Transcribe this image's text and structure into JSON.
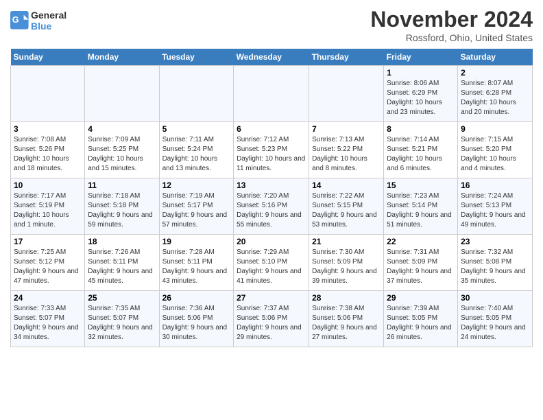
{
  "logo": {
    "line1": "General",
    "line2": "Blue"
  },
  "title": "November 2024",
  "location": "Rossford, Ohio, United States",
  "days_of_week": [
    "Sunday",
    "Monday",
    "Tuesday",
    "Wednesday",
    "Thursday",
    "Friday",
    "Saturday"
  ],
  "weeks": [
    [
      {
        "day": "",
        "info": ""
      },
      {
        "day": "",
        "info": ""
      },
      {
        "day": "",
        "info": ""
      },
      {
        "day": "",
        "info": ""
      },
      {
        "day": "",
        "info": ""
      },
      {
        "day": "1",
        "info": "Sunrise: 8:06 AM\nSunset: 6:29 PM\nDaylight: 10 hours and 23 minutes."
      },
      {
        "day": "2",
        "info": "Sunrise: 8:07 AM\nSunset: 6:28 PM\nDaylight: 10 hours and 20 minutes."
      }
    ],
    [
      {
        "day": "3",
        "info": "Sunrise: 7:08 AM\nSunset: 5:26 PM\nDaylight: 10 hours and 18 minutes."
      },
      {
        "day": "4",
        "info": "Sunrise: 7:09 AM\nSunset: 5:25 PM\nDaylight: 10 hours and 15 minutes."
      },
      {
        "day": "5",
        "info": "Sunrise: 7:11 AM\nSunset: 5:24 PM\nDaylight: 10 hours and 13 minutes."
      },
      {
        "day": "6",
        "info": "Sunrise: 7:12 AM\nSunset: 5:23 PM\nDaylight: 10 hours and 11 minutes."
      },
      {
        "day": "7",
        "info": "Sunrise: 7:13 AM\nSunset: 5:22 PM\nDaylight: 10 hours and 8 minutes."
      },
      {
        "day": "8",
        "info": "Sunrise: 7:14 AM\nSunset: 5:21 PM\nDaylight: 10 hours and 6 minutes."
      },
      {
        "day": "9",
        "info": "Sunrise: 7:15 AM\nSunset: 5:20 PM\nDaylight: 10 hours and 4 minutes."
      }
    ],
    [
      {
        "day": "10",
        "info": "Sunrise: 7:17 AM\nSunset: 5:19 PM\nDaylight: 10 hours and 1 minute."
      },
      {
        "day": "11",
        "info": "Sunrise: 7:18 AM\nSunset: 5:18 PM\nDaylight: 9 hours and 59 minutes."
      },
      {
        "day": "12",
        "info": "Sunrise: 7:19 AM\nSunset: 5:17 PM\nDaylight: 9 hours and 57 minutes."
      },
      {
        "day": "13",
        "info": "Sunrise: 7:20 AM\nSunset: 5:16 PM\nDaylight: 9 hours and 55 minutes."
      },
      {
        "day": "14",
        "info": "Sunrise: 7:22 AM\nSunset: 5:15 PM\nDaylight: 9 hours and 53 minutes."
      },
      {
        "day": "15",
        "info": "Sunrise: 7:23 AM\nSunset: 5:14 PM\nDaylight: 9 hours and 51 minutes."
      },
      {
        "day": "16",
        "info": "Sunrise: 7:24 AM\nSunset: 5:13 PM\nDaylight: 9 hours and 49 minutes."
      }
    ],
    [
      {
        "day": "17",
        "info": "Sunrise: 7:25 AM\nSunset: 5:12 PM\nDaylight: 9 hours and 47 minutes."
      },
      {
        "day": "18",
        "info": "Sunrise: 7:26 AM\nSunset: 5:11 PM\nDaylight: 9 hours and 45 minutes."
      },
      {
        "day": "19",
        "info": "Sunrise: 7:28 AM\nSunset: 5:11 PM\nDaylight: 9 hours and 43 minutes."
      },
      {
        "day": "20",
        "info": "Sunrise: 7:29 AM\nSunset: 5:10 PM\nDaylight: 9 hours and 41 minutes."
      },
      {
        "day": "21",
        "info": "Sunrise: 7:30 AM\nSunset: 5:09 PM\nDaylight: 9 hours and 39 minutes."
      },
      {
        "day": "22",
        "info": "Sunrise: 7:31 AM\nSunset: 5:09 PM\nDaylight: 9 hours and 37 minutes."
      },
      {
        "day": "23",
        "info": "Sunrise: 7:32 AM\nSunset: 5:08 PM\nDaylight: 9 hours and 35 minutes."
      }
    ],
    [
      {
        "day": "24",
        "info": "Sunrise: 7:33 AM\nSunset: 5:07 PM\nDaylight: 9 hours and 34 minutes."
      },
      {
        "day": "25",
        "info": "Sunrise: 7:35 AM\nSunset: 5:07 PM\nDaylight: 9 hours and 32 minutes."
      },
      {
        "day": "26",
        "info": "Sunrise: 7:36 AM\nSunset: 5:06 PM\nDaylight: 9 hours and 30 minutes."
      },
      {
        "day": "27",
        "info": "Sunrise: 7:37 AM\nSunset: 5:06 PM\nDaylight: 9 hours and 29 minutes."
      },
      {
        "day": "28",
        "info": "Sunrise: 7:38 AM\nSunset: 5:06 PM\nDaylight: 9 hours and 27 minutes."
      },
      {
        "day": "29",
        "info": "Sunrise: 7:39 AM\nSunset: 5:05 PM\nDaylight: 9 hours and 26 minutes."
      },
      {
        "day": "30",
        "info": "Sunrise: 7:40 AM\nSunset: 5:05 PM\nDaylight: 9 hours and 24 minutes."
      }
    ]
  ]
}
